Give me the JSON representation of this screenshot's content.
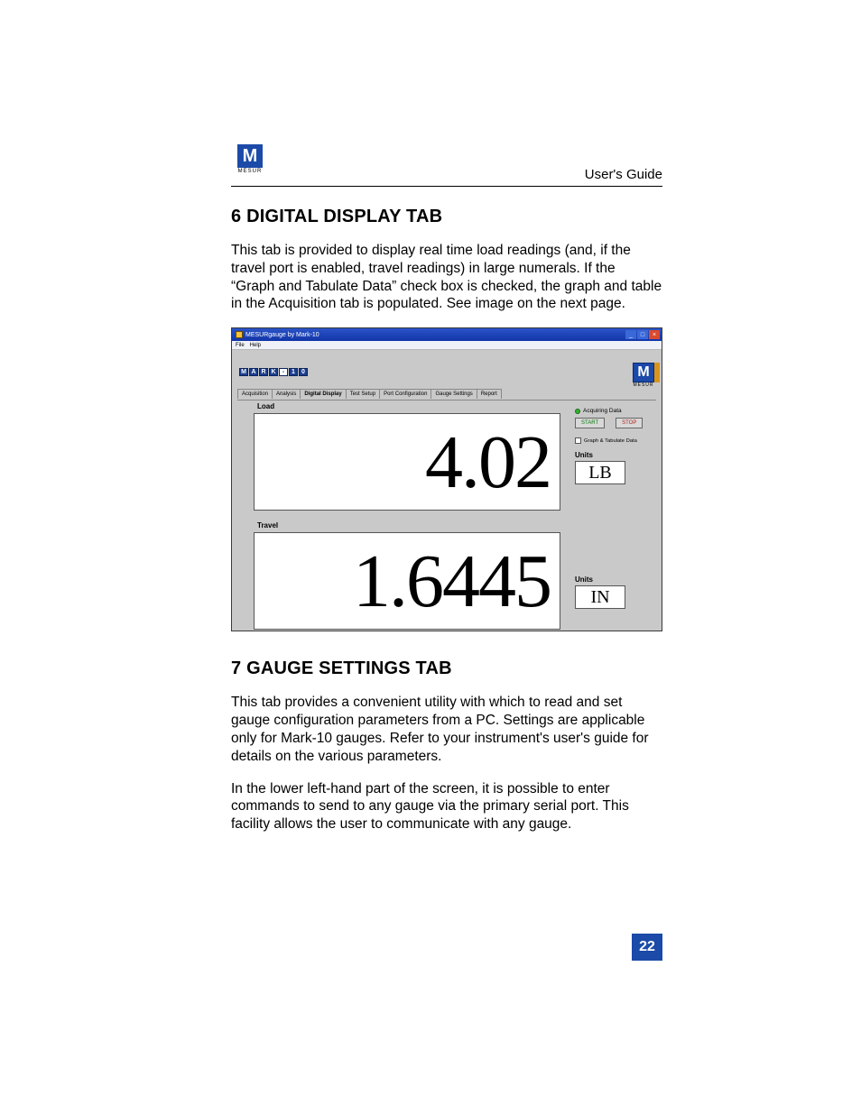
{
  "header": {
    "guide_label": "User's Guide",
    "logo_letter": "M",
    "logo_sub": "MESUR"
  },
  "section6": {
    "title": "6  DIGITAL DISPLAY TAB",
    "para": "This tab is provided to display real time load readings (and, if the travel port is enabled, travel readings) in large numerals. If the “Graph and Tabulate Data” check box is checked, the graph and table in the Acquisition tab is populated. See image on the next page."
  },
  "section7": {
    "title": "7  GAUGE SETTINGS TAB",
    "para1": "This tab provides a convenient utility with which to read and set gauge configuration parameters from a PC. Settings are applicable only for Mark-10 gauges. Refer to your instrument's user's guide for details on the various parameters.",
    "para2": "In the lower left-hand part of the screen, it is possible to enter commands to send to any gauge via the primary serial port. This facility allows the user to communicate with any gauge."
  },
  "page_number": "22",
  "app": {
    "title": "MESURgauge by Mark-10",
    "menu": {
      "file": "File",
      "help": "Help"
    },
    "brand_chars": [
      "M",
      "A",
      "R",
      "K",
      "-",
      "1",
      "0"
    ],
    "tabs": [
      "Acquisition",
      "Analysis",
      "Digital Display",
      "Test Setup",
      "Port Configuration",
      "Gauge Settings",
      "Report"
    ],
    "active_tab_index": 2,
    "load_label": "Load",
    "travel_label": "Travel",
    "load_value": "4.02",
    "travel_value": "1.6445",
    "acquiring_label": "Acquiring Data",
    "start_label": "START",
    "stop_label": "STOP",
    "graph_tab_label": "Graph & Tabulate Data",
    "units_label": "Units",
    "units_load": "LB",
    "units_travel": "IN",
    "mesur_mini": {
      "letter": "M",
      "sub": "MESUR"
    }
  }
}
